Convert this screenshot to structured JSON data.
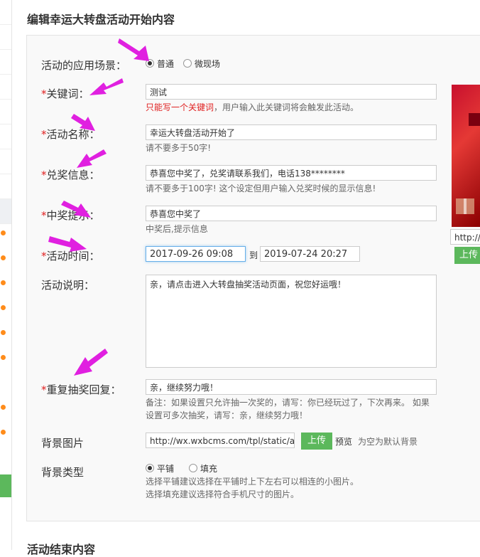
{
  "page": {
    "title": "编辑幸运大转盘活动开始内容",
    "next_section_title": "活动结束内容"
  },
  "form": {
    "scene": {
      "label": "活动的应用场景：",
      "options": [
        "普通",
        "微现场"
      ],
      "selected": "普通"
    },
    "keyword": {
      "label": "关键词：",
      "required_mark": "*",
      "value": "测试",
      "hint_red": "只能写一个关键词",
      "hint_rest": "，用户输入此关键词将会触发此活动。"
    },
    "activity_name": {
      "label": "活动名称：",
      "required_mark": "*",
      "value": "幸运大转盘活动开始了",
      "hint": "请不要多于50字!"
    },
    "redeem_info": {
      "label": "兑奖信息：",
      "required_mark": "*",
      "value": "恭喜您中奖了，兑奖请联系我们，电话138********",
      "hint": "请不要多于100字! 这个设定但用户输入兑奖时候的显示信息!"
    },
    "win_tip": {
      "label": "中奖提示：",
      "required_mark": "*",
      "value": "恭喜您中奖了",
      "hint": "中奖后,提示信息"
    },
    "activity_time": {
      "label": "活动时间：",
      "required_mark": "*",
      "start": "2017-09-26 09:08",
      "separator": "到",
      "end": "2019-07-24 20:27"
    },
    "description": {
      "label": "活动说明：",
      "value": "亲，请点击进入大转盘抽奖活动页面，祝您好运哦！"
    },
    "repeat_reply": {
      "label": "重复抽奖回复：",
      "required_mark": "*",
      "value": "亲，继续努力哦！",
      "hint_line1": "备注：如果设置只允许抽一次奖的，请写：你已经玩过了，下次再来。 如果",
      "hint_line2": "设置可多次抽奖，请写：亲，继续努力哦！"
    },
    "bg_image": {
      "label": "背景图片",
      "value": "http://wx.wxbcms.com/tpl/static/at",
      "upload_label": "上传",
      "preview_label": "预览",
      "hint": "为空为默认背景"
    },
    "bg_type": {
      "label": "背景类型",
      "options": [
        "平铺",
        "填充"
      ],
      "selected": "平铺",
      "hint_line1": "选择平铺建议选择在平铺时上下左右可以相连的小图片。",
      "hint_line2": "选择填充建议选择符合手机尺寸的图片。"
    }
  },
  "side_preview": {
    "url_value": "http://",
    "upload_label": "上传"
  },
  "colors": {
    "required": "#e02020",
    "upload_green": "#5cb85c",
    "annotation_arrow": "#e020e0",
    "status_dot": "#ff8c1a"
  }
}
